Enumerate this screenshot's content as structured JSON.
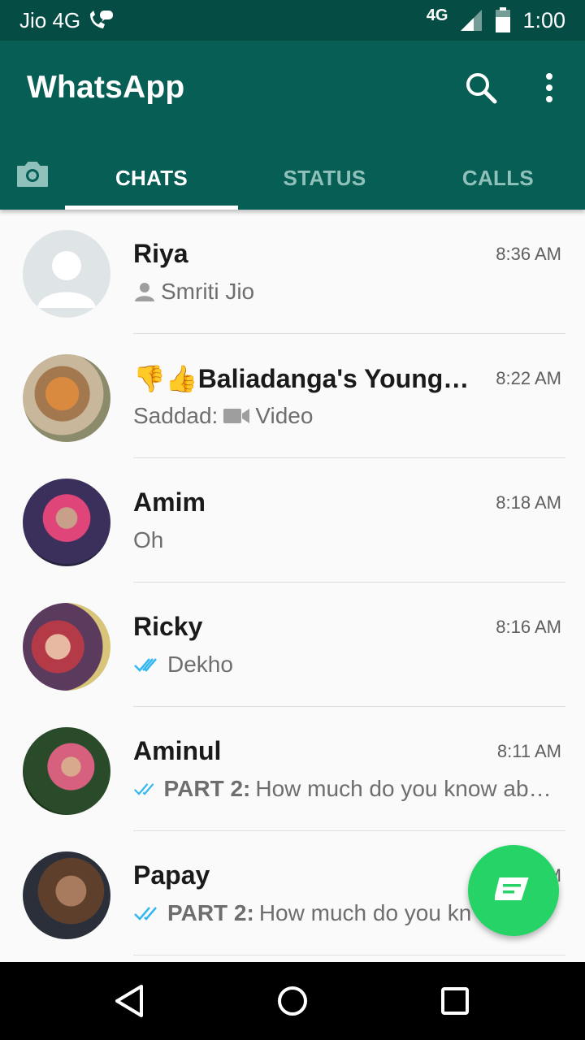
{
  "status_bar": {
    "carrier": "Jio 4G",
    "network": "4G",
    "clock": "1:00"
  },
  "app_bar": {
    "title": "WhatsApp",
    "search_icon": "search-icon",
    "more_icon": "more-vert-icon"
  },
  "tabs": {
    "camera_icon": "camera-icon",
    "items": [
      {
        "label": "CHATS",
        "active": true
      },
      {
        "label": "STATUS",
        "active": false
      },
      {
        "label": "CALLS",
        "active": false
      }
    ]
  },
  "chats": [
    {
      "name": "Riya",
      "time": "8:36 AM",
      "prefix": "",
      "prefix_icon": "person-icon",
      "message": "Smriti Jio"
    },
    {
      "name": "👎👍Baliadanga's Youngsters",
      "time": "8:22 AM",
      "prefix": "Saddad: ",
      "prefix_icon": "video-icon",
      "message": "Video"
    },
    {
      "name": "Amim",
      "time": "8:18 AM",
      "prefix": "",
      "prefix_icon": "",
      "message": "Oh"
    },
    {
      "name": "Ricky",
      "time": "8:16 AM",
      "prefix": "",
      "prefix_icon": "double-tick-icon",
      "message": "Dekho"
    },
    {
      "name": "Aminul",
      "time": "8:11 AM",
      "prefix": "PART 2:",
      "prefix_icon": "double-tick-icon",
      "message": " How much do you know about me"
    },
    {
      "name": "Papay",
      "time": "M",
      "prefix": "PART 2:",
      "prefix_icon": "double-tick-icon",
      "message": " How much do you kn"
    }
  ],
  "fab": {
    "icon": "new-chat-icon"
  },
  "colors": {
    "header": "#075e54",
    "status_bar": "#054d44",
    "accent": "#25d366",
    "read_tick": "#34b7f1"
  }
}
